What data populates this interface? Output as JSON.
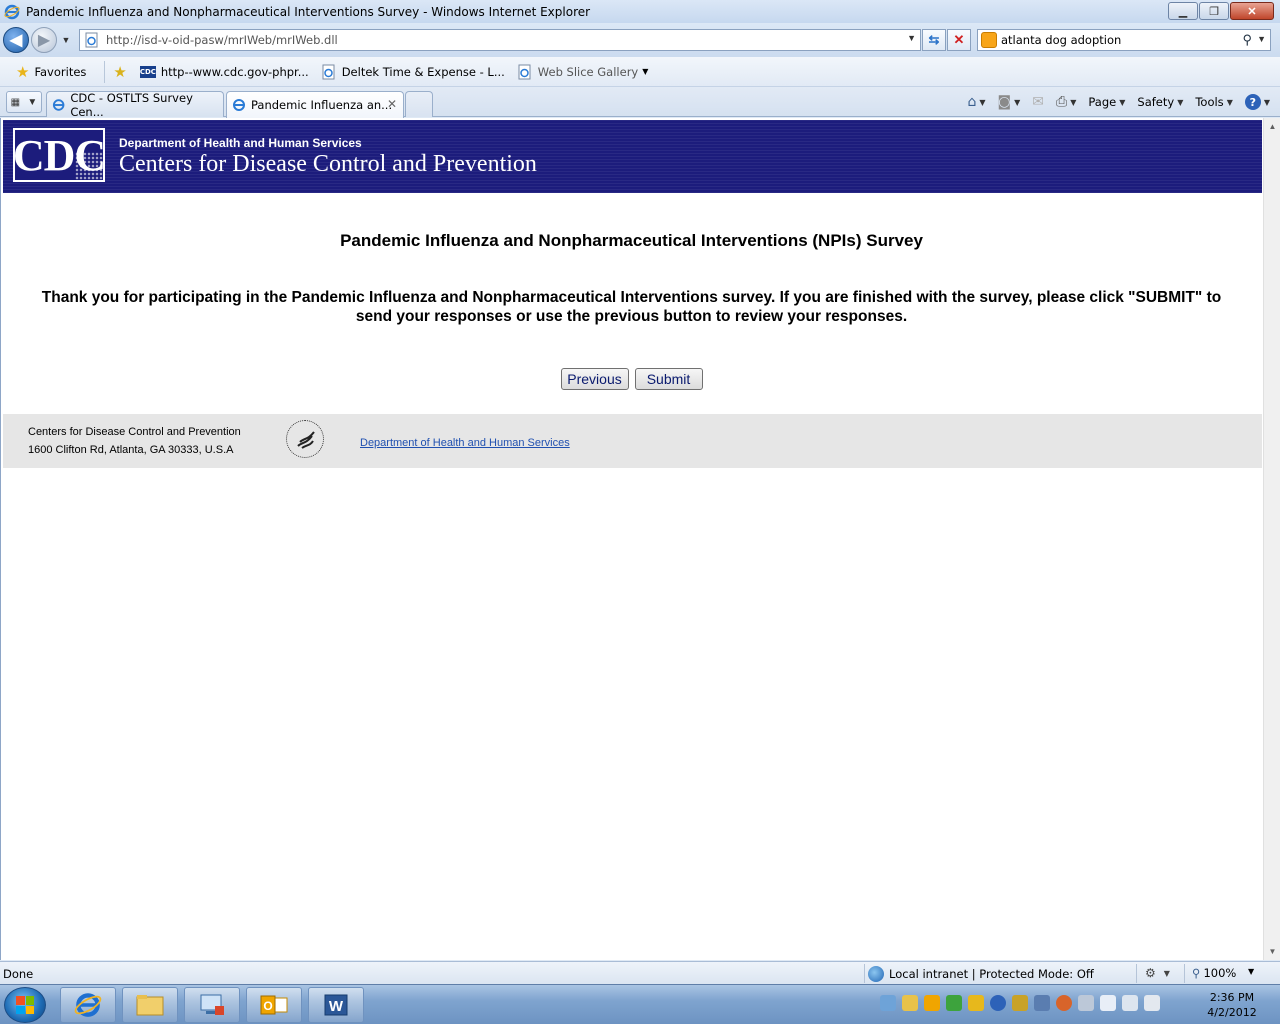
{
  "window": {
    "title": "Pandemic Influenza and Nonpharmaceutical Interventions Survey - Windows Internet Explorer"
  },
  "address_bar": {
    "url": "http://isd-v-oid-pasw/mrIWeb/mrIWeb.dll"
  },
  "search": {
    "value": "atlanta dog adoption"
  },
  "favorites_bar": {
    "favorites_label": "Favorites",
    "items": [
      {
        "label": "http--www.cdc.gov-phpr...",
        "icon": "cdc-icon"
      },
      {
        "label": "Deltek Time & Expense - L...",
        "icon": "ie-page-icon"
      },
      {
        "label": "Web Slice Gallery",
        "icon": "ie-page-icon"
      }
    ]
  },
  "tabs": [
    {
      "label": "CDC - OSTLTS Survey Cen...",
      "active": false
    },
    {
      "label": "Pandemic Influenza an...",
      "active": true
    }
  ],
  "command_bar": {
    "page": "Page",
    "safety": "Safety",
    "tools": "Tools"
  },
  "page": {
    "header": {
      "logo_text": "CDC",
      "department": "Department of Health and Human Services",
      "agency": "Centers for Disease Control and Prevention"
    },
    "survey_title": "Pandemic Influenza and Nonpharmaceutical Interventions (NPIs) Survey",
    "message": "Thank you for participating in the Pandemic Influenza and Nonpharmaceutical Interventions survey. If you are finished with the survey, please click \"SUBMIT\" to send your responses or use the previous button to review your responses.",
    "buttons": {
      "previous": "Previous",
      "submit": "Submit"
    },
    "footer": {
      "org": "Centers for Disease Control and Prevention",
      "address": "1600 Clifton Rd, Atlanta, GA 30333, U.S.A",
      "hhs_link": "Department of Health and Human Services"
    }
  },
  "status_bar": {
    "status": "Done",
    "zone": "Local intranet | Protected Mode: Off",
    "zoom": "100%"
  },
  "taskbar": {
    "apps": [
      "internet-explorer",
      "windows-explorer",
      "remote-desktop",
      "outlook",
      "word"
    ],
    "time": "2:36 PM",
    "date": "4/2/2012"
  },
  "colors": {
    "cdc_header_bg": "#1c1c7c",
    "footer_bg": "#e6e6e6",
    "link": "#2050b0",
    "button_text": "#0a1a6e"
  }
}
